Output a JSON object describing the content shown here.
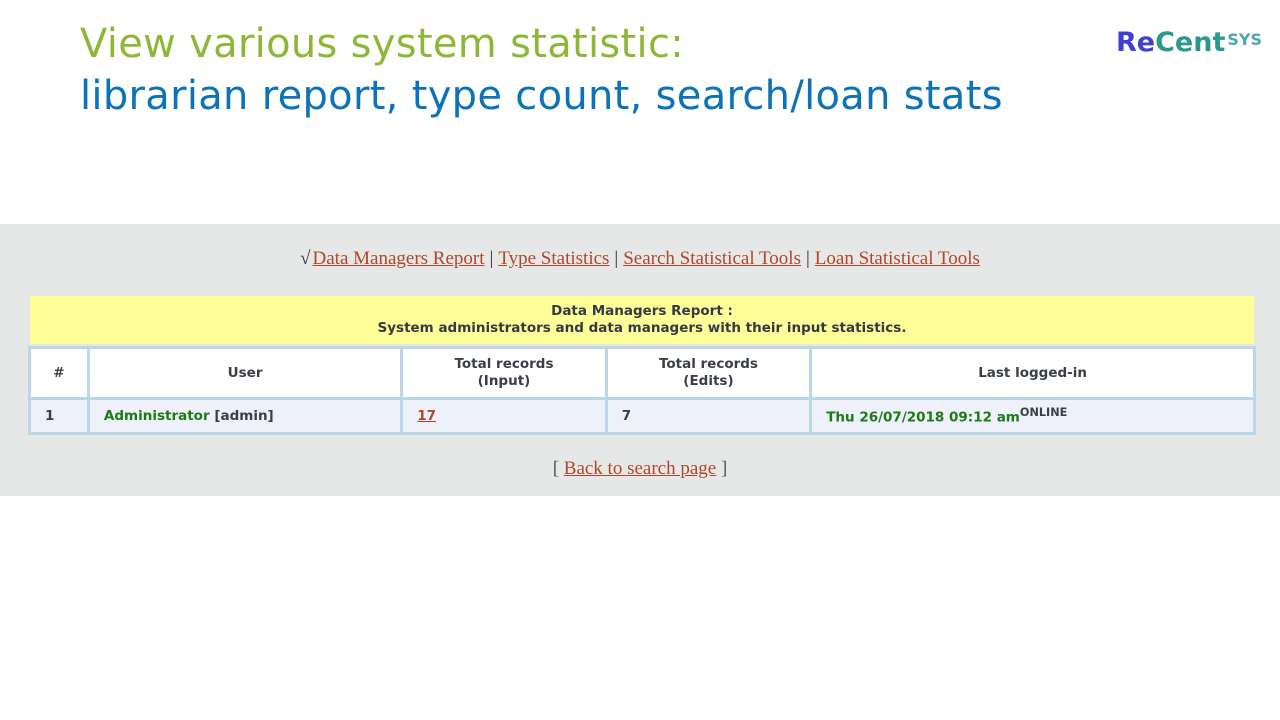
{
  "slide": {
    "title_line1": "View various system statistic:",
    "title_line2": "librarian report, type count, search/loan stats",
    "title_line1_color": "#8db837",
    "title_line2_color": "#0c73b8"
  },
  "logo": {
    "part1": "Re",
    "part2": "Cent",
    "part3": "SYS",
    "colors": [
      "#3f3fd1",
      "#2a9a8e",
      "#49a8b2"
    ]
  },
  "nav": {
    "check": "√",
    "items": [
      {
        "label": "Data Managers Report"
      },
      {
        "label": "Type Statistics"
      },
      {
        "label": "Search Statistical Tools"
      },
      {
        "label": "Loan Statistical Tools"
      }
    ],
    "separator": "|",
    "link_color": "#b0472a"
  },
  "report": {
    "title": "Data Managers Report :",
    "subtitle": "System administrators and data managers with their input statistics.",
    "columns": {
      "index": "#",
      "user": "User",
      "input_line1": "Total records",
      "input_line2": "(Input)",
      "edits_line1": "Total records",
      "edits_line2": "(Edits)",
      "last_login": "Last logged-in"
    },
    "rows": [
      {
        "index": "1",
        "user_name": "Administrator",
        "user_login": "[admin]",
        "input": "17",
        "edits": "7",
        "last_login": "Thu 26/07/2018 09:12 am",
        "status": "ONLINE"
      }
    ]
  },
  "back": {
    "open": "[",
    "label": "Back to search page",
    "close": "]"
  }
}
